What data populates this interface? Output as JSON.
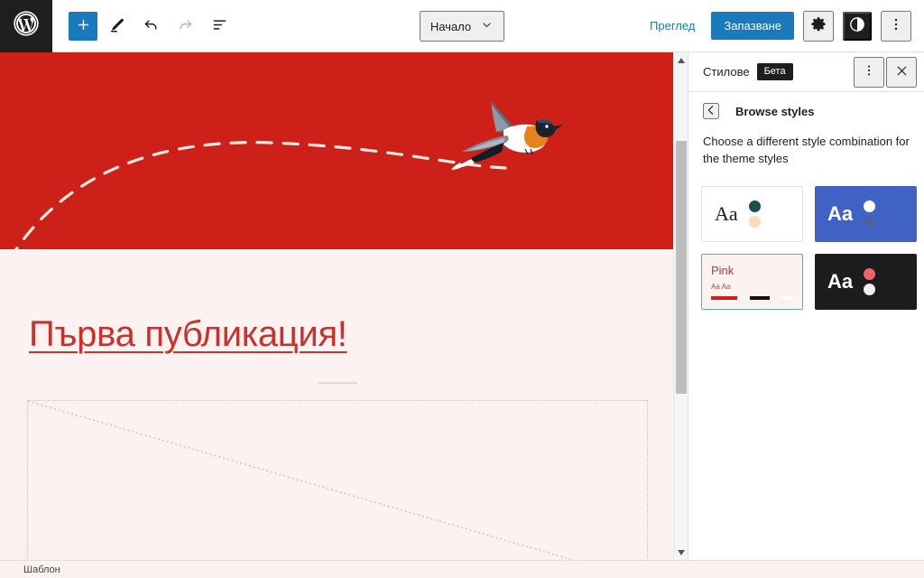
{
  "toolbar": {
    "wp_logo": "wordpress-logo",
    "add_block_label": "+",
    "tools": [
      {
        "name": "add-block-button",
        "label": "+"
      },
      {
        "name": "edit-tool-button",
        "label": "Edit"
      },
      {
        "name": "undo-button",
        "label": "Undo"
      },
      {
        "name": "redo-button",
        "label": "Redo"
      },
      {
        "name": "list-view-button",
        "label": "List View"
      }
    ],
    "document_title": "Начало",
    "preview_label": "Преглед",
    "save_label": "Запазване",
    "settings_label": "Settings",
    "styles_label": "Styles",
    "options_label": "Options"
  },
  "canvas": {
    "hero_color": "#cc2018",
    "background_color": "#fdf2f2",
    "post_title": "Първа публикация!",
    "title_color": "#c8322a",
    "image_placeholder_label": "image-placeholder"
  },
  "sidebar": {
    "title": "Стилове",
    "badge": "Бета",
    "back_label": "Back",
    "section_title": "Browse styles",
    "description": "Choose a different style combination for the theme styles",
    "styles": [
      {
        "id": "default",
        "variant": "light",
        "sample_text": "Aa",
        "selected": false,
        "background": "#ffffff",
        "text_color": "#1e1e1e",
        "dots": [
          "#1b4f4a",
          "#fbdcb8"
        ]
      },
      {
        "id": "blue",
        "variant": "blue",
        "sample_text": "Aa",
        "selected": false,
        "background": "#3f62c4",
        "text_color": "#ffffff",
        "dots": [
          "#ffffff",
          "#4a63a0"
        ]
      },
      {
        "id": "pink",
        "variant": "pink",
        "title": "Pink",
        "sample_text": "Aa Aa",
        "selected": true,
        "background": "#fdf2f2",
        "text_color": "#c8322a",
        "bars": [
          "#cc2018",
          "#111111"
        ]
      },
      {
        "id": "dark",
        "variant": "dark",
        "sample_text": "Aa",
        "selected": false,
        "background": "#1c1c1c",
        "text_color": "#ffffff",
        "dots": [
          "#f0626b",
          "#f0f0f0"
        ]
      }
    ]
  },
  "bottom_bar": {
    "label": "Шаблон"
  }
}
